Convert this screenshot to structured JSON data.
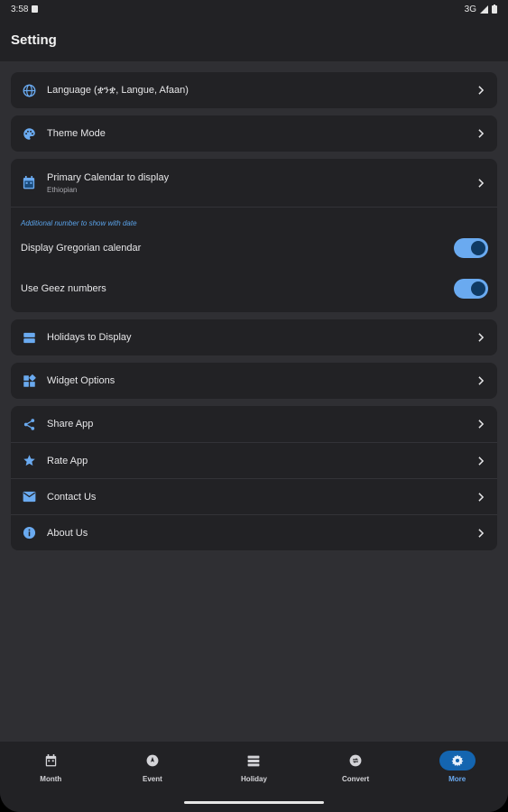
{
  "status_bar": {
    "time": "3:58",
    "network": "3G"
  },
  "app_bar": {
    "title": "Setting"
  },
  "settings": {
    "language": "Language (ቋንቋ, Langue, Afaan)",
    "theme_mode": "Theme Mode",
    "primary_calendar": {
      "title": "Primary Calendar to display",
      "value": "Ethiopian"
    },
    "additional_caption": "Additional number to show with date",
    "display_gregorian": {
      "label": "Display Gregorian calendar",
      "enabled": true
    },
    "use_geez": {
      "label": "Use Geez numbers",
      "enabled": true
    },
    "holidays": "Holidays to Display",
    "widget_options": "Widget Options",
    "share_app": "Share App",
    "rate_app": "Rate App",
    "contact_us": "Contact Us",
    "about_us": "About Us"
  },
  "nav": {
    "items": [
      {
        "label": "Month",
        "icon": "calendar-month-icon"
      },
      {
        "label": "Event",
        "icon": "event-icon"
      },
      {
        "label": "Holiday",
        "icon": "holiday-list-icon"
      },
      {
        "label": "Convert",
        "icon": "convert-icon"
      },
      {
        "label": "More",
        "icon": "gear-icon",
        "active": true
      }
    ]
  },
  "colors": {
    "accent": "#6aaaf0",
    "surface": "#222225",
    "background": "#2f2f33"
  }
}
